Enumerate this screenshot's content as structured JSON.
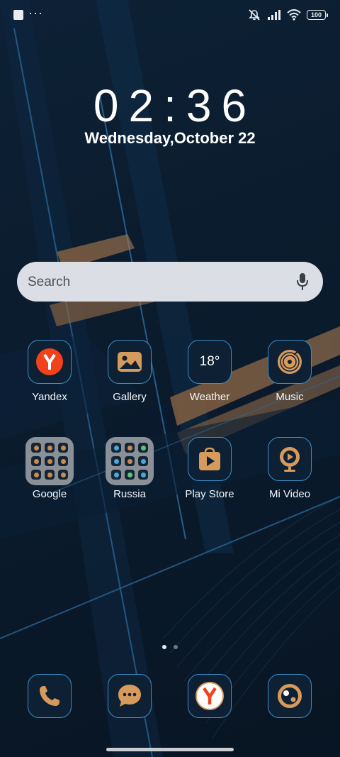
{
  "status_bar": {
    "left_icons": [
      "notification-square-icon",
      "more-dots-icon"
    ],
    "right_icons": [
      "mute-icon",
      "signal-icon",
      "wifi-icon",
      "battery-icon"
    ],
    "more_text": "···",
    "battery_level": "100"
  },
  "clock": {
    "time": "02:36",
    "date": "Wednesday,October 22"
  },
  "search": {
    "placeholder": "Search",
    "icon": "microphone-icon"
  },
  "apps": [
    {
      "label": "Yandex",
      "icon": "yandex-icon"
    },
    {
      "label": "Gallery",
      "icon": "gallery-icon"
    },
    {
      "label": "Weather",
      "icon": "weather-icon",
      "temperature": "18°"
    },
    {
      "label": "Music",
      "icon": "music-icon"
    },
    {
      "label": "Google",
      "icon": "folder-icon"
    },
    {
      "label": "Russia",
      "icon": "folder-icon"
    },
    {
      "label": "Play Store",
      "icon": "play-store-icon"
    },
    {
      "label": "Mi Video",
      "icon": "mi-video-icon"
    }
  ],
  "pager": {
    "pages": 2,
    "current": 1
  },
  "dock": [
    {
      "icon": "phone-icon"
    },
    {
      "icon": "messages-icon"
    },
    {
      "icon": "yandex-browser-icon"
    },
    {
      "icon": "camera-icon"
    }
  ],
  "colors": {
    "accent_copper": "#c98b4f",
    "icon_border": "#3b8fc6",
    "yandex_red": "#f2421c",
    "background": "#0b1c2e"
  }
}
